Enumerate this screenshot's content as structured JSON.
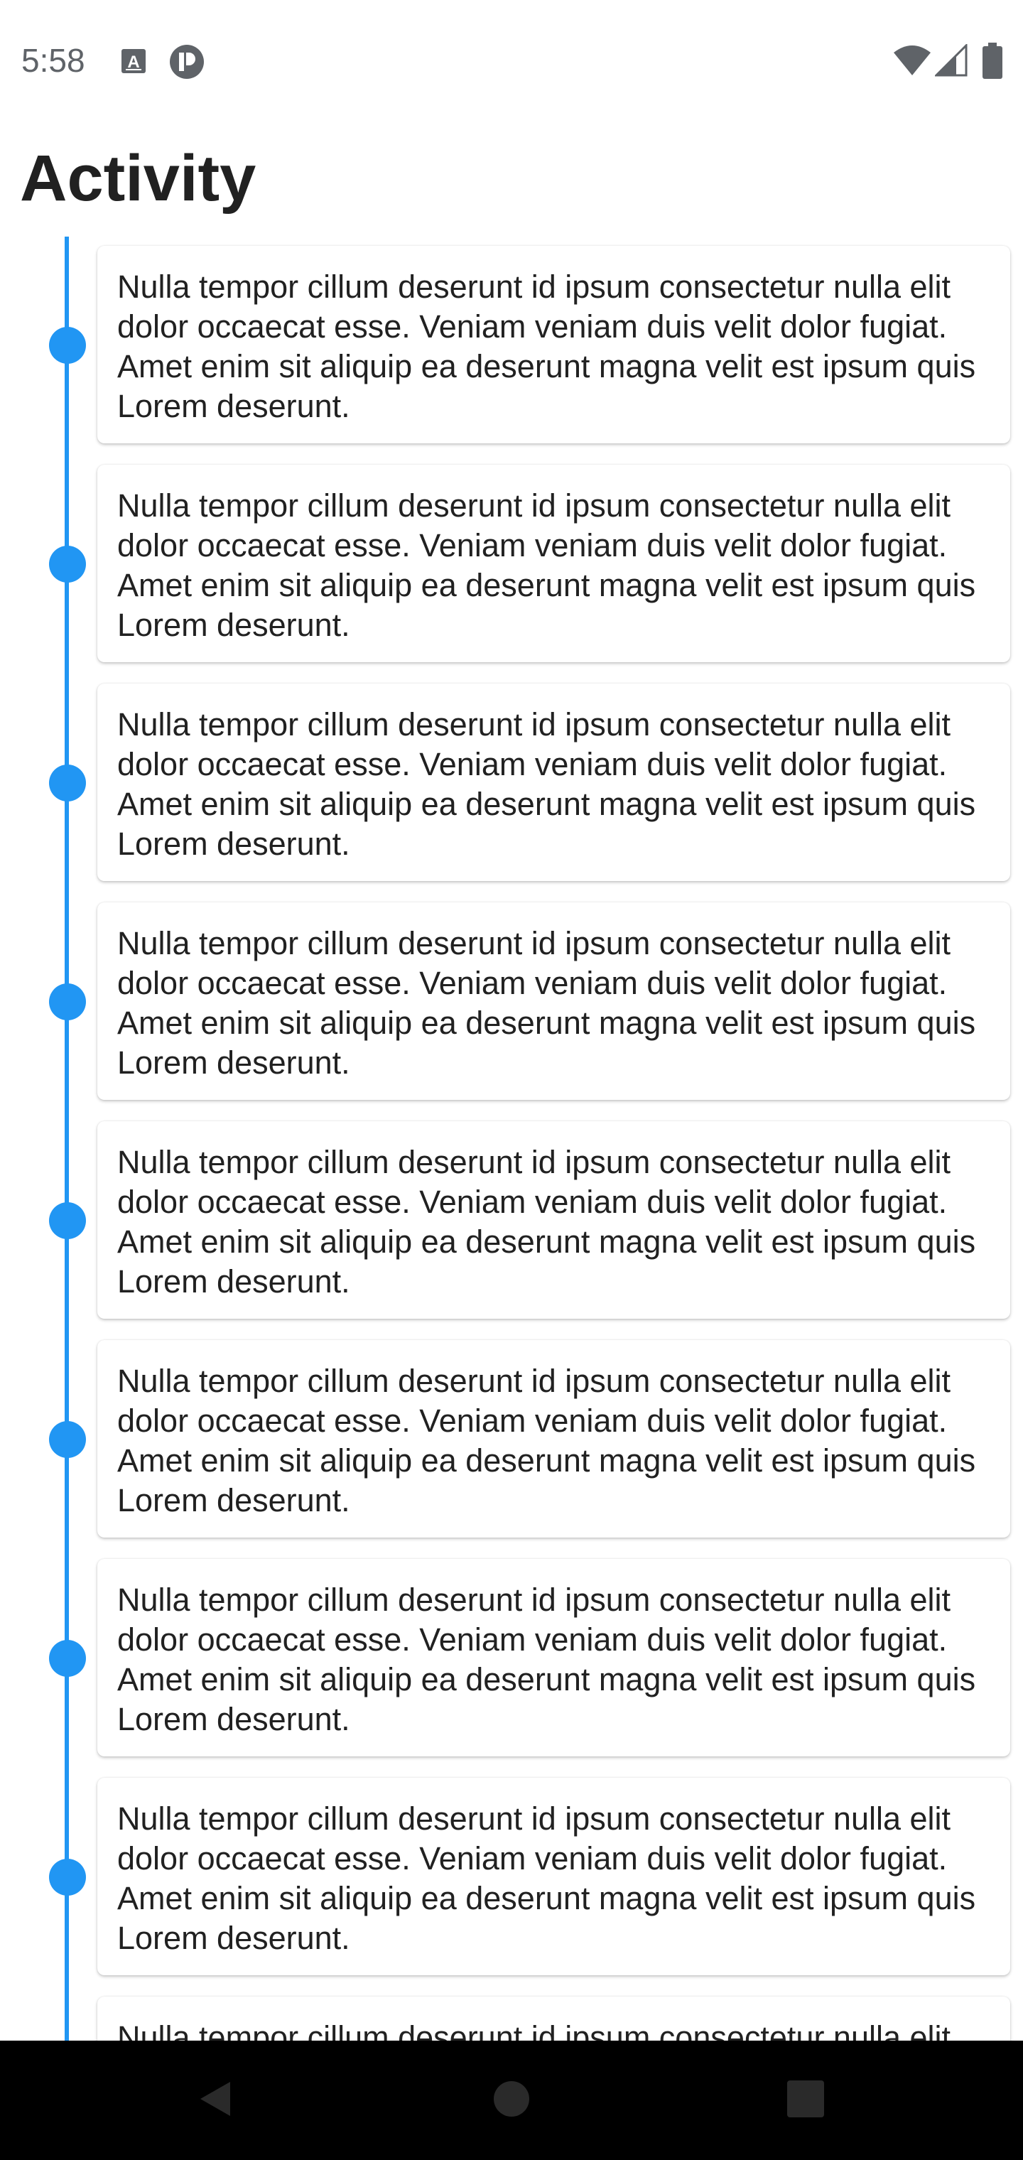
{
  "status_bar": {
    "time": "5:58",
    "left_icons": [
      "text-a-icon",
      "app-notification-icon"
    ],
    "right_icons": [
      "wifi-icon",
      "cellular-signal-icon",
      "battery-icon"
    ]
  },
  "header": {
    "title": "Activity"
  },
  "timeline": {
    "accent_color": "#2196f3",
    "entries": [
      {
        "text": "Nulla tempor cillum deserunt id ipsum consectetur nulla elit dolor occaecat esse. Veniam veniam duis velit dolor fugiat. Amet enim sit aliquip ea deserunt magna velit est ipsum quis Lorem deserunt."
      },
      {
        "text": "Nulla tempor cillum deserunt id ipsum consectetur nulla elit dolor occaecat esse. Veniam veniam duis velit dolor fugiat. Amet enim sit aliquip ea deserunt magna velit est ipsum quis Lorem deserunt."
      },
      {
        "text": "Nulla tempor cillum deserunt id ipsum consectetur nulla elit dolor occaecat esse. Veniam veniam duis velit dolor fugiat. Amet enim sit aliquip ea deserunt magna velit est ipsum quis Lorem deserunt."
      },
      {
        "text": "Nulla tempor cillum deserunt id ipsum consectetur nulla elit dolor occaecat esse. Veniam veniam duis velit dolor fugiat. Amet enim sit aliquip ea deserunt magna velit est ipsum quis Lorem deserunt."
      },
      {
        "text": "Nulla tempor cillum deserunt id ipsum consectetur nulla elit dolor occaecat esse. Veniam veniam duis velit dolor fugiat. Amet enim sit aliquip ea deserunt magna velit est ipsum quis Lorem deserunt."
      },
      {
        "text": "Nulla tempor cillum deserunt id ipsum consectetur nulla elit dolor occaecat esse. Veniam veniam duis velit dolor fugiat. Amet enim sit aliquip ea deserunt magna velit est ipsum quis Lorem deserunt."
      },
      {
        "text": "Nulla tempor cillum deserunt id ipsum consectetur nulla elit dolor occaecat esse. Veniam veniam duis velit dolor fugiat. Amet enim sit aliquip ea deserunt magna velit est ipsum quis Lorem deserunt."
      },
      {
        "text": "Nulla tempor cillum deserunt id ipsum consectetur nulla elit dolor occaecat esse. Veniam veniam duis velit dolor fugiat. Amet enim sit aliquip ea deserunt magna velit est ipsum quis Lorem deserunt."
      },
      {
        "text": "Nulla tempor cillum deserunt id ipsum consectetur nulla elit dolor occaecat esse. Veniam veniam duis velit dolor fugiat. Amet enim sit aliquip ea deserunt magna velit est ipsum quis Lorem deserunt."
      }
    ]
  },
  "nav_bar": {
    "buttons": [
      "back-icon",
      "home-icon",
      "recents-icon"
    ]
  }
}
